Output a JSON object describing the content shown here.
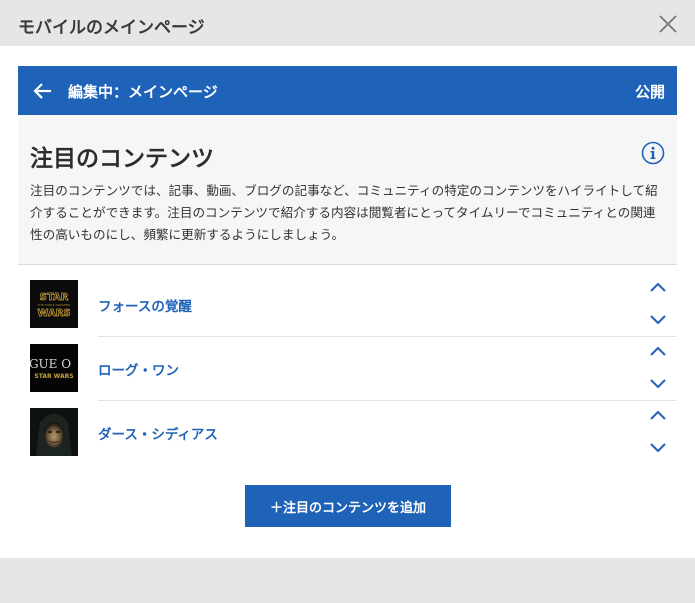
{
  "window": {
    "title": "モバイルのメインページ",
    "close_icon": "close-icon"
  },
  "editor_bar": {
    "back_icon": "arrow-left-icon",
    "label": "編集中：メインページ",
    "publish_label": "公開",
    "background": "#1f63b8"
  },
  "section": {
    "title": "注目のコンテンツ",
    "info_icon": "info-icon",
    "description": "注目のコンテンツでは、記事、動画、ブログの記事など、コミュニティの特定のコンテンツをハイライトして紹介することができます。注目のコンテンツで紹介する内容は閲覧者にとってタイムリーでコミュニティとの関連性の高いものにし、頻繁に更新するようにしましょう。"
  },
  "items": [
    {
      "title": "フォースの覚醒",
      "thumb_text_top": "STAR",
      "thumb_text_bottom": "WARS",
      "thumb_subtitle": "THE FORCE AWAKENS"
    },
    {
      "title": "ローグ・ワン",
      "thumb_text_top": "GUE O",
      "thumb_text_bottom": "STAR WARS"
    },
    {
      "title": "ダース・シディアス"
    }
  ],
  "add_button": {
    "label": "＋注目のコンテンツを追加"
  }
}
